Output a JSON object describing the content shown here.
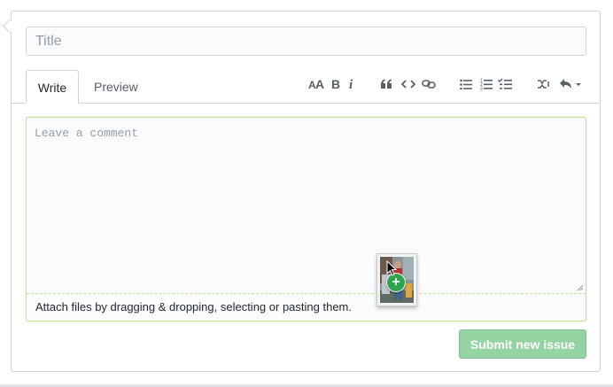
{
  "form": {
    "title_placeholder": "Title",
    "title_value": ""
  },
  "tabs": [
    {
      "label": "Write",
      "active": true
    },
    {
      "label": "Preview",
      "active": false
    }
  ],
  "toolbar": {
    "icons": [
      "header-icon",
      "bold-icon",
      "italic-icon",
      "quote-icon",
      "code-icon",
      "link-icon",
      "bullet-list-icon",
      "numbered-list-icon",
      "task-list-icon",
      "mention-icon",
      "reply-icon"
    ]
  },
  "comment": {
    "placeholder": "Leave a comment",
    "value": "",
    "attach_hint": "Attach files by dragging & dropping, selecting or pasting them."
  },
  "submit": {
    "label": "Submit new issue",
    "color": "#94d3a2"
  },
  "colors": {
    "focus_border": "#c4e48f",
    "border": "#d1d5da",
    "badge_green": "#2ea44f"
  }
}
